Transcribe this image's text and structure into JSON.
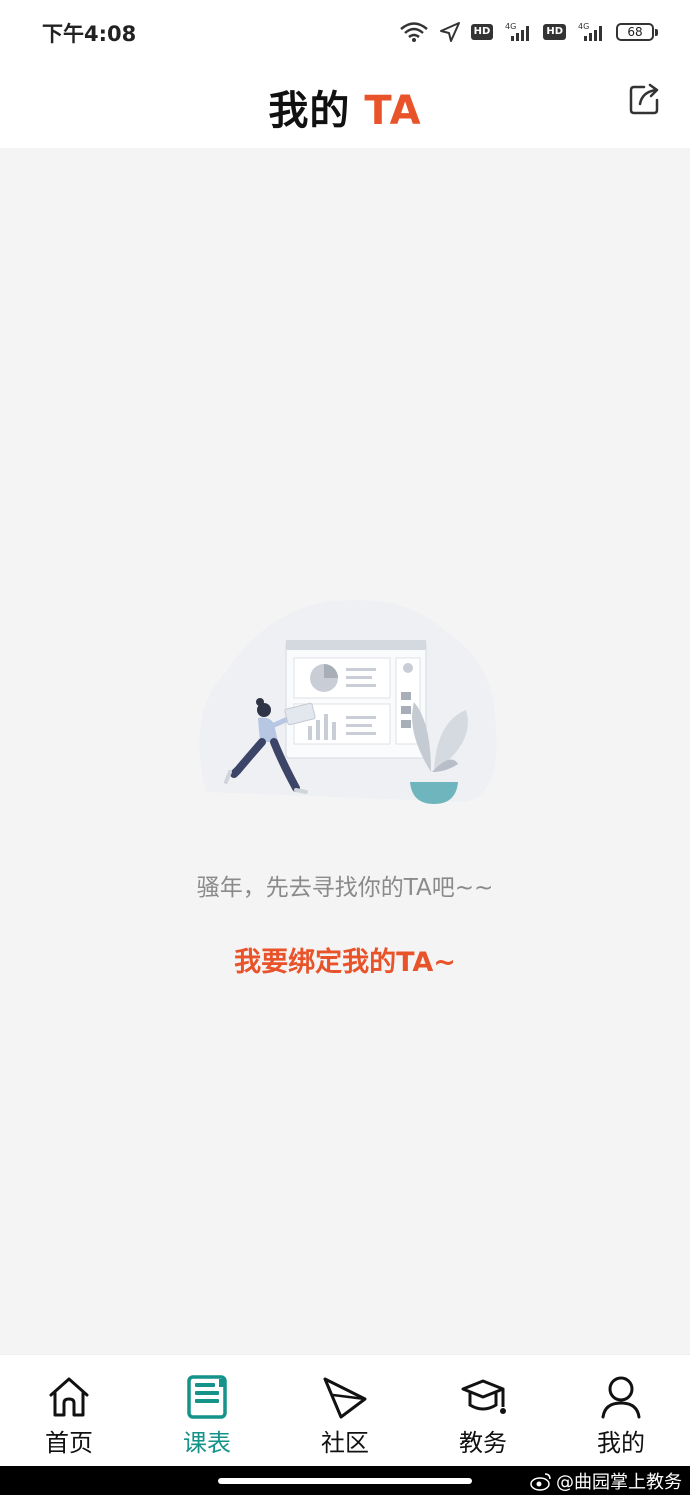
{
  "status_bar": {
    "time": "下午4:08",
    "hd1": "HD",
    "hd2": "HD",
    "battery": "68"
  },
  "header": {
    "title_main": "我的",
    "title_accent": "TA"
  },
  "main": {
    "empty_text": "骚年，先去寻找你的TA吧~~",
    "bind_link": "我要绑定我的TA~"
  },
  "tabbar": {
    "items": [
      {
        "label": "首页",
        "icon": "home-icon"
      },
      {
        "label": "课表",
        "icon": "schedule-icon"
      },
      {
        "label": "社区",
        "icon": "paper-plane-icon"
      },
      {
        "label": "教务",
        "icon": "graduation-cap-icon"
      },
      {
        "label": "我的",
        "icon": "user-icon"
      }
    ],
    "active_index": 1
  },
  "watermark": {
    "text": "@曲园掌上教务"
  },
  "colors": {
    "accent": "#e8532a",
    "active_tab": "#13938a",
    "background": "#f4f4f4"
  }
}
